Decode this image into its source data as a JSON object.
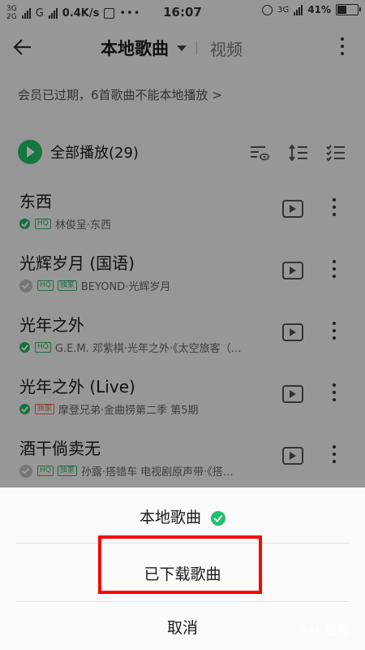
{
  "status_bar": {
    "net1": "3G",
    "net2": "2G",
    "net3": "G",
    "speed": "0.4K/s",
    "time": "16:07",
    "net_right": "3G",
    "battery": "41%",
    "battery_level": 0.41
  },
  "header": {
    "title": "本地歌曲",
    "tab_video": "视频"
  },
  "notice": "会员已过期，6首歌曲不能本地播放 >",
  "play_all": "全部播放(29)",
  "songs": [
    {
      "title": "东西",
      "tags": [
        "HQ"
      ],
      "meta": "林俊呈·东西",
      "downloaded": true
    },
    {
      "title": "光辉岁月 (国语)",
      "tags": [
        "HQ",
        "独家"
      ],
      "meta": "BEYOND·光辉岁月",
      "downloaded": false
    },
    {
      "title": "光年之外",
      "tags": [
        "HQ"
      ],
      "meta": "G.E.M. 邓紫棋·光年之外·《太空旅客（…",
      "downloaded": true
    },
    {
      "title": "光年之外 (Live)",
      "tags": [
        "独家"
      ],
      "meta": "摩登兄弟·金曲捞第二季 第5期",
      "downloaded": true
    },
    {
      "title": "酒干倘卖无",
      "tags": [
        "HQ",
        "独家"
      ],
      "meta": "孙露·搭错车 电视剧原声带·《搭…",
      "downloaded": false
    }
  ],
  "sheet": {
    "option1": "本地歌曲",
    "option2": "已下载歌曲",
    "option3": "取消"
  },
  "watermark": "Bai 经验",
  "colors": {
    "accent": "#20c06b",
    "highlight": "#ff0000"
  }
}
